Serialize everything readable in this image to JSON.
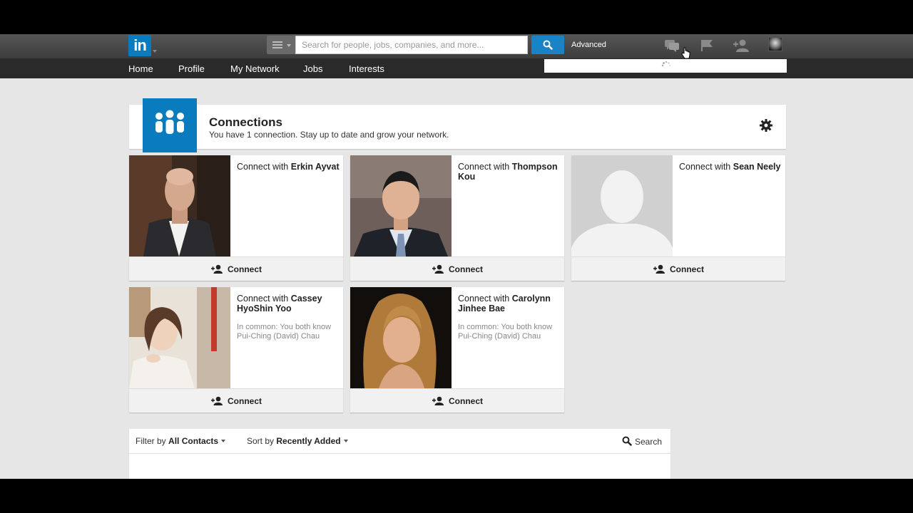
{
  "topbar": {
    "logo_text": "in",
    "search_placeholder": "Search for people, jobs, companies, and more...",
    "advanced_label": "Advanced",
    "icons": [
      "messages-icon",
      "flag-icon",
      "add-connection-icon",
      "profile-avatar"
    ]
  },
  "nav": {
    "items": [
      "Home",
      "Profile",
      "My Network",
      "Jobs",
      "Interests"
    ]
  },
  "connections": {
    "title": "Connections",
    "subtitle": "You have 1 connection. Stay up to date and grow your network."
  },
  "cards": [
    {
      "prefix": "Connect with",
      "name": "Erkin Ayvat",
      "common": "",
      "action": "Connect"
    },
    {
      "prefix": "Connect with",
      "name": "Thompson Kou",
      "common": "",
      "action": "Connect"
    },
    {
      "prefix": "Connect with",
      "name": "Sean Neely",
      "common": "",
      "action": "Connect"
    },
    {
      "prefix": "Connect with",
      "name": "Cassey HyoShin Yoo",
      "common": "In common: You both know Pui-Ching (David) Chau",
      "action": "Connect"
    },
    {
      "prefix": "Connect with",
      "name": "Carolynn Jinhee Bae",
      "common": "In common: You both know Pui-Ching (David) Chau",
      "action": "Connect"
    }
  ],
  "filter": {
    "filter_label": "Filter by",
    "filter_value": "All Contacts",
    "sort_label": "Sort by",
    "sort_value": "Recently Added",
    "search_label": "Search"
  },
  "colors": {
    "brand": "#0a7bbd",
    "topbar": "#4a4a4a",
    "navbar": "#2a2a2a",
    "background": "#e6e6e6"
  }
}
